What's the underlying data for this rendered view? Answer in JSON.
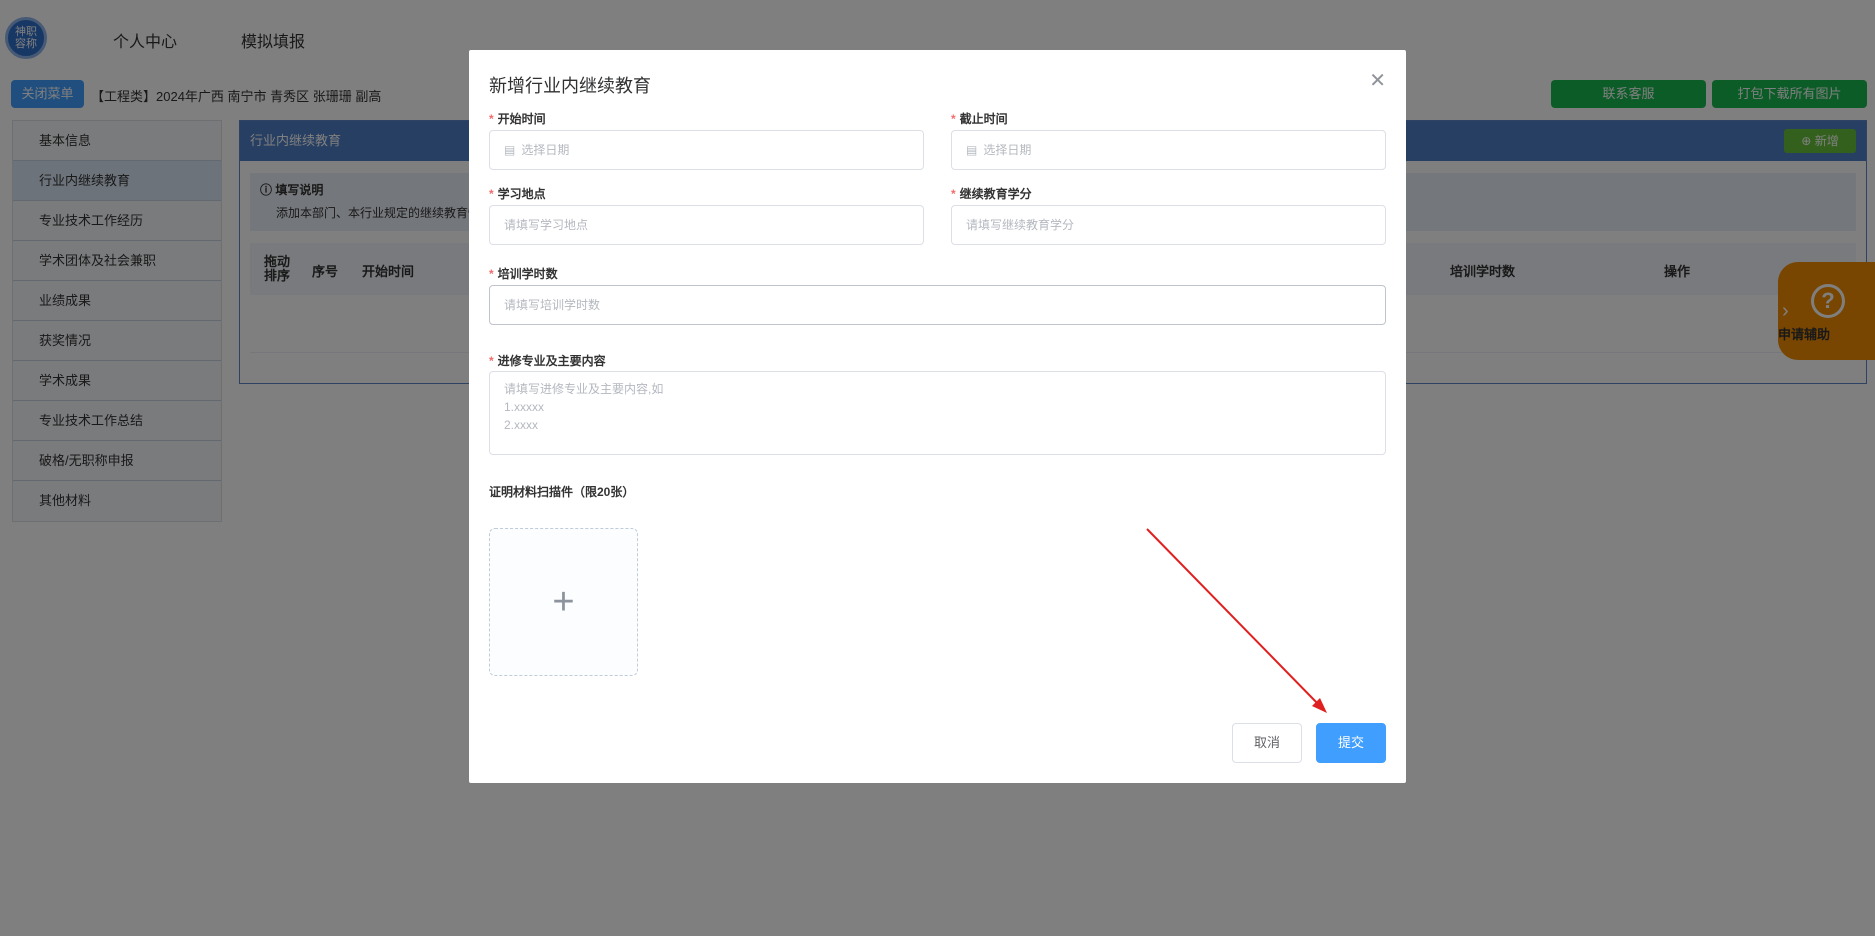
{
  "header": {
    "logo_text": "神职\n容称",
    "nav": [
      "个人中心",
      "模拟填报"
    ]
  },
  "subbar": {
    "close_menu": "关闭菜单",
    "breadcrumb": "【工程类】2024年广西 南宁市 青秀区 张珊珊 副高",
    "contact": "联系客服",
    "download_all": "打包下载所有图片"
  },
  "sidebar": {
    "items": [
      "基本信息",
      "行业内继续教育",
      "专业技术工作经历",
      "学术团体及社会兼职",
      "业绩成果",
      "获奖情况",
      "学术成果",
      "专业技术工作总结",
      "破格/无职称申报",
      "其他材料"
    ]
  },
  "main": {
    "title": "行业内继续教育",
    "add_button": "新增",
    "note_title": "填写说明",
    "note_text": "添加本部门、本行业规定的继续教育情",
    "columns": [
      "拖动\n排序",
      "序号",
      "开始时间",
      "培训学时数",
      "操作"
    ]
  },
  "helper": {
    "label": "申请辅助",
    "icon": "?"
  },
  "dialog": {
    "title": "新增行业内继续教育",
    "fields": {
      "start_label": "开始时间",
      "start_placeholder": "选择日期",
      "end_label": "截止时间",
      "end_placeholder": "选择日期",
      "place_label": "学习地点",
      "place_placeholder": "请填写学习地点",
      "credit_label": "继续教育学分",
      "credit_placeholder": "请填写继续教育学分",
      "hours_label": "培训学时数",
      "hours_placeholder": "请填写培训学时数",
      "content_label": "进修专业及主要内容",
      "content_placeholder": "请填写进修专业及主要内容,如\n1.xxxxx\n2.xxxx",
      "upload_label": "证明材料扫描件（限20张）"
    },
    "cancel": "取消",
    "submit": "提交"
  }
}
